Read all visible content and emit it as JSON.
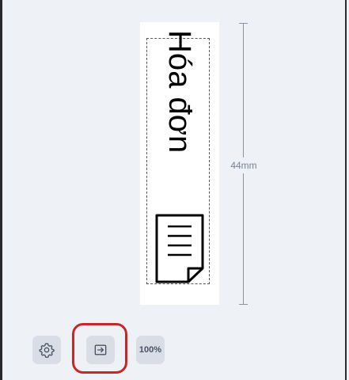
{
  "label": {
    "text": "Hóa đơn",
    "icon": "document-icon",
    "dimension": "44mm"
  },
  "toolbar": {
    "settings_icon": "gear-icon",
    "export_icon": "export-arrow-icon",
    "zoom_label": "100%"
  },
  "colors": {
    "highlight": "#c62828",
    "canvas_bg": "#eef1f5",
    "button_bg": "#d9dee6"
  }
}
